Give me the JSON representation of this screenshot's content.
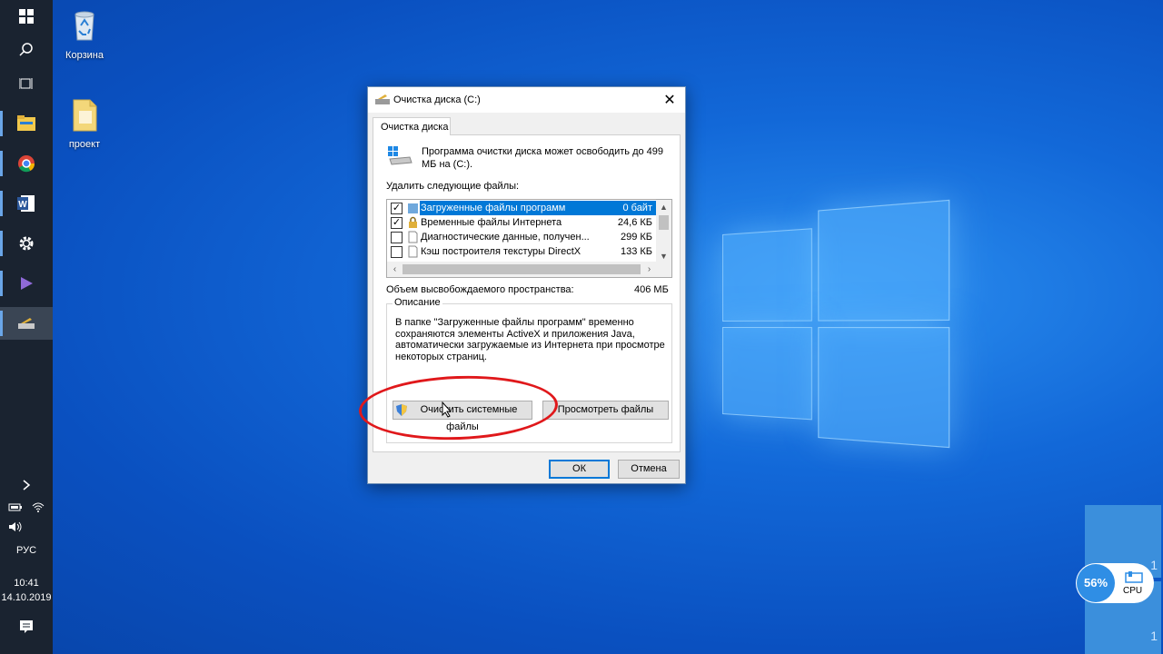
{
  "desktop": {
    "icons": [
      {
        "label": "Корзина"
      },
      {
        "label": "проект"
      }
    ]
  },
  "taskbar": {
    "language": "РУС",
    "time": "10:41",
    "date": "14.10.2019"
  },
  "dialog": {
    "title": "Очистка диска  (C:)",
    "tab": "Очистка диска",
    "intro": "Программа очистки диска может освободить до 499 МБ на  (C:).",
    "files_to_delete_label": "Удалить следующие файлы:",
    "files": [
      {
        "name": "Загруженные файлы программ",
        "size": "0 байт",
        "checked": true
      },
      {
        "name": "Временные файлы Интернета",
        "size": "24,6 КБ",
        "checked": true
      },
      {
        "name": "Диагностические данные, получен...",
        "size": "299 КБ",
        "checked": false
      },
      {
        "name": "Кэш построителя текстуры DirectX",
        "size": "133 КБ",
        "checked": false
      }
    ],
    "space_label": "Объем высвобождаемого пространства:",
    "space_value": "406 МБ",
    "description_legend": "Описание",
    "description_text": "В папке \"Загруженные файлы программ\" временно сохраняются элементы ActiveX и приложения Java, автоматически загружаемые из Интернета при просмотре некоторых страниц.",
    "cleanup_system_button": "Очистить системные файлы",
    "view_files_button": "Просмотреть файлы",
    "ok_button": "ОК",
    "cancel_button": "Отмена",
    "check_mark": "✓",
    "close_glyph": "✕"
  },
  "cpu_widget": {
    "percent": "56%",
    "label": "CPU",
    "tile_numbers": [
      "1",
      "1"
    ]
  },
  "colors": {
    "selection": "#0078d7",
    "highlight_ring": "#e0181b",
    "taskbar": "#1a2330"
  }
}
